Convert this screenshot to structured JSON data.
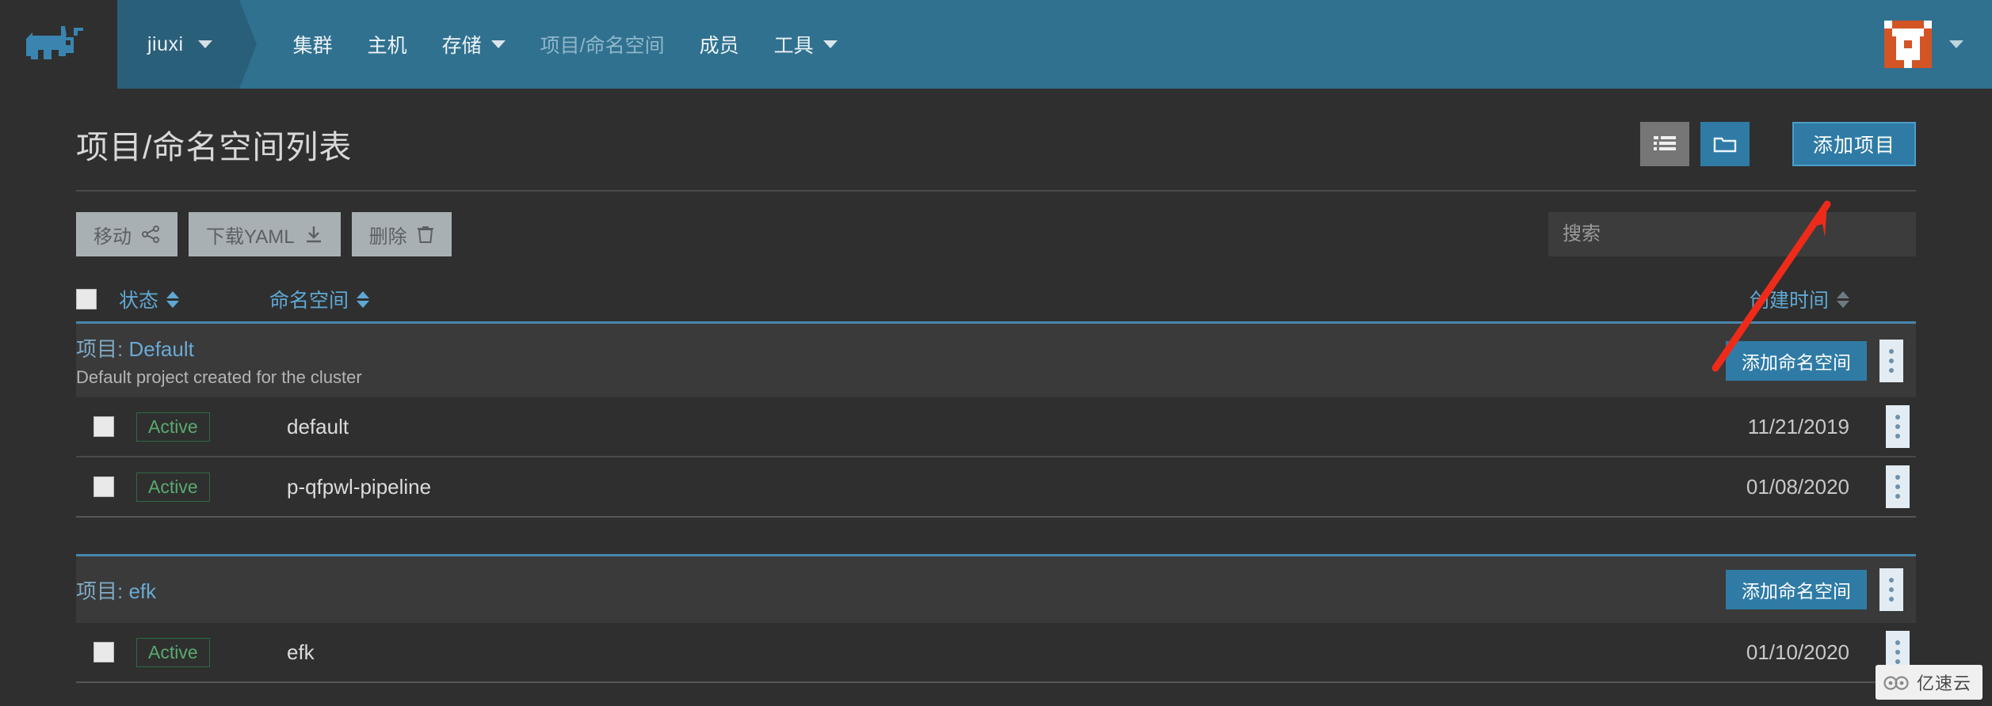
{
  "header": {
    "logo_icon": "rancher-cow-logo",
    "context_switcher": {
      "label": "jiuxi",
      "icon": "chevron-down-icon"
    },
    "nav_items": [
      {
        "label": "集群",
        "has_caret": false,
        "active": false
      },
      {
        "label": "主机",
        "has_caret": false,
        "active": false
      },
      {
        "label": "存储",
        "has_caret": true,
        "active": false
      },
      {
        "label": "项目/命名空间",
        "has_caret": false,
        "active": true
      },
      {
        "label": "成员",
        "has_caret": false,
        "active": false
      },
      {
        "label": "工具",
        "has_caret": true,
        "active": false
      }
    ],
    "avatar": {
      "icon": "user-avatar-identicon"
    },
    "avatar_menu_icon": "chevron-down-icon",
    "accent_color": "#30718f",
    "context_color": "#2a5f7a"
  },
  "page": {
    "title": "项目/命名空间列表",
    "view_toggles": [
      {
        "name": "list-view",
        "icon": "list-view-icon",
        "active": true
      },
      {
        "name": "folder-view",
        "icon": "folder-view-icon",
        "active": false
      }
    ],
    "add_project_label": "添加项目"
  },
  "toolbar": {
    "move_label": "移动",
    "move_icon": "share-nodes-icon",
    "download_label": "下载YAML",
    "download_icon": "download-icon",
    "delete_label": "删除",
    "delete_icon": "trash-icon",
    "search_placeholder": "搜索",
    "search_value": ""
  },
  "table": {
    "columns": {
      "status": "状态",
      "namespace": "命名空间",
      "created": "创建时间"
    },
    "select_all_checked": false,
    "add_namespace_label": "添加命名空间",
    "row_menu_icon": "kebab-menu-icon",
    "groups": [
      {
        "label": "项目:",
        "name": "Default",
        "description": "Default project created for the cluster",
        "rows": [
          {
            "status": "Active",
            "namespace": "default",
            "created": "11/21/2019"
          },
          {
            "status": "Active",
            "namespace": "p-qfpwl-pipeline",
            "created": "01/08/2020"
          }
        ]
      },
      {
        "label": "项目:",
        "name": "efk",
        "description": "",
        "rows": [
          {
            "status": "Active",
            "namespace": "efk",
            "created": "01/10/2020"
          }
        ]
      }
    ]
  },
  "annotation": {
    "type": "red-arrow",
    "color": "#ee2b1a",
    "points_from": "添加命名空间",
    "points_to": "添加项目"
  },
  "watermark": {
    "text": "亿速云",
    "icon": "cloud-icon"
  }
}
